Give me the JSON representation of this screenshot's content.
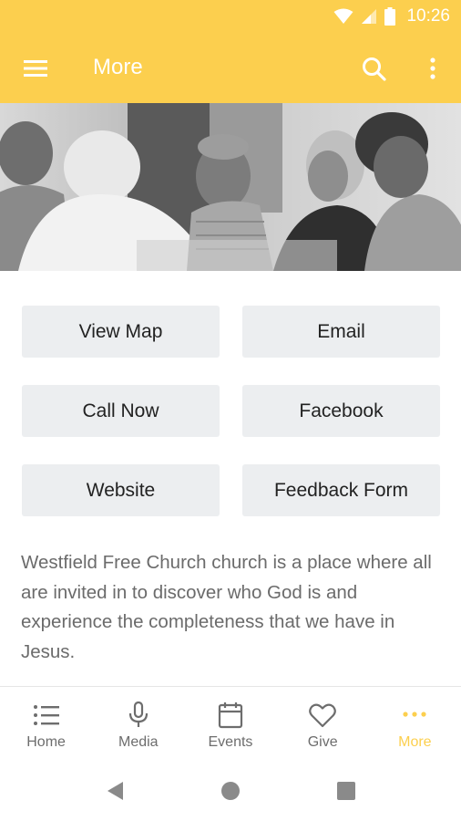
{
  "status": {
    "time": "10:26"
  },
  "toolbar": {
    "title": "More"
  },
  "actions": [
    {
      "label": "View Map"
    },
    {
      "label": "Email"
    },
    {
      "label": "Call Now"
    },
    {
      "label": "Facebook"
    },
    {
      "label": "Website"
    },
    {
      "label": "Feedback Form"
    }
  ],
  "description": "Westfield Free Church church is a place where all are invited in to discover who God is and experience the completeness that we have in Jesus.",
  "bottom_nav": [
    {
      "label": "Home",
      "icon": "list-icon",
      "active": false
    },
    {
      "label": "Media",
      "icon": "microphone-icon",
      "active": false
    },
    {
      "label": "Events",
      "icon": "calendar-icon",
      "active": false
    },
    {
      "label": "Give",
      "icon": "heart-icon",
      "active": false
    },
    {
      "label": "More",
      "icon": "more-dots-icon",
      "active": true
    }
  ],
  "colors": {
    "accent": "#FCCF4E",
    "button_bg": "#ECEEF0",
    "text_muted": "#6b6b6b"
  }
}
